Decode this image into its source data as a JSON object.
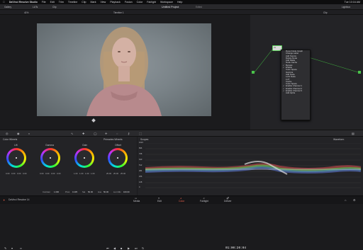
{
  "menubar": {
    "items": [
      "DaVinci Resolve Studio",
      "File",
      "Edit",
      "Trim",
      "Timeline",
      "Clip",
      "Mark",
      "View",
      "Playback",
      "Fusion",
      "Color",
      "Fairlight",
      "Workspace",
      "Help"
    ],
    "clock": "Tue 10:16 AM"
  },
  "toolbar": {
    "gallery": "Gallery",
    "luts": "LUTs",
    "clip": "Clip",
    "timeline": "Timeline 1",
    "project_title": "Untitled Project",
    "edited": "Edited",
    "zoom": "41%",
    "nodes_label": "Clip",
    "lightbox": "Lightbox"
  },
  "viewer": {
    "timecode": "01:00:20:04",
    "clip_label": "00:00:00:00"
  },
  "node_menu": {
    "items": [
      {
        "label": "Reset Node Graph",
        "checked": false
      },
      {
        "label": "Change Label",
        "checked": false
      },
      {
        "label": "Add Source",
        "checked": false
      },
      {
        "label": "Delete Node",
        "checked": false
      },
      {
        "label": "Add Matte",
        "checked": false
      },
      {
        "label": "Node Cache",
        "checked": false
      },
      {
        "label": "Bypass",
        "checked": true
      },
      {
        "label": "Enable",
        "checked": true
      },
      {
        "label": "Color Space",
        "checked": false
      },
      {
        "label": "Gamma",
        "checked": false
      },
      {
        "label": "Add Node",
        "checked": false
      },
      {
        "label": "Lock Node",
        "checked": false
      },
      {
        "label": "LUT",
        "checked": false
      },
      {
        "label": "Cache",
        "checked": false
      },
      {
        "label": "Color Space",
        "checked": false
      },
      {
        "label": "Enable Channel 1",
        "checked": true
      },
      {
        "label": "Enable Channel 2",
        "checked": true
      },
      {
        "label": "Enable Channel 3",
        "checked": true
      },
      {
        "label": "Add Alpha",
        "checked": false
      }
    ],
    "node_label": "01"
  },
  "wheels_panel": {
    "title": "Color Wheels",
    "mode": "Primaries Wheels",
    "wheels": [
      {
        "label": "Lift",
        "values": [
          "0.00",
          "0.00",
          "0.00",
          "0.00"
        ]
      },
      {
        "label": "Gamma",
        "values": [
          "0.00",
          "0.00",
          "0.00",
          "0.00"
        ]
      },
      {
        "label": "Gain",
        "values": [
          "1.00",
          "1.00",
          "1.00",
          "1.00"
        ]
      },
      {
        "label": "Offset",
        "values": [
          "25.00",
          "25.00",
          "25.00"
        ]
      }
    ],
    "bottom": {
      "contrast_label": "Contrast",
      "contrast": "1.000",
      "pivot_label": "Pivot",
      "pivot": "0.435",
      "sat_label": "Sat",
      "sat": "50.00",
      "hue_label": "Hue",
      "hue": "50.00",
      "lummix_label": "Lum Mix",
      "lummix": "100.00"
    }
  },
  "scopes": {
    "title": "Scopes",
    "mode": "Waveform",
    "ticks": [
      "1023",
      "896",
      "768",
      "640",
      "512",
      "384",
      "256",
      "128",
      "0"
    ]
  },
  "bottom_nav": {
    "app": "DaVinci Resolve 14",
    "pages": [
      "Media",
      "Edit",
      "Color",
      "Fairlight",
      "Deliver"
    ],
    "active": "Color"
  },
  "colors": {
    "accent": "#e8604c",
    "node_green": "#4ac24a",
    "timecode": "#e8e8ea"
  }
}
